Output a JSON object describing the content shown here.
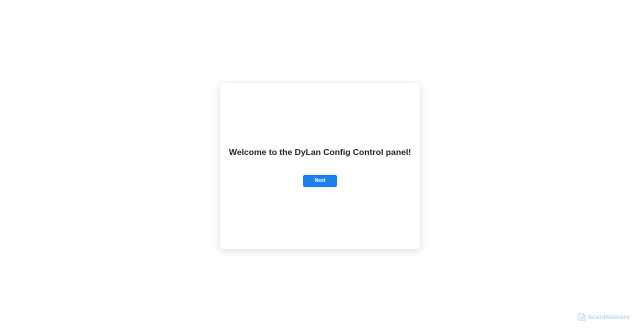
{
  "panel": {
    "heading": "Welcome to the DyLan Config Control panel!",
    "next_label": "Next"
  },
  "watermark": {
    "text": "ScanMalware",
    "icon": "scanmalware-logo-icon"
  },
  "colors": {
    "background": "#ffffff",
    "button": "#1a7fef",
    "heading": "#222222",
    "watermark": "#b9cde6"
  }
}
